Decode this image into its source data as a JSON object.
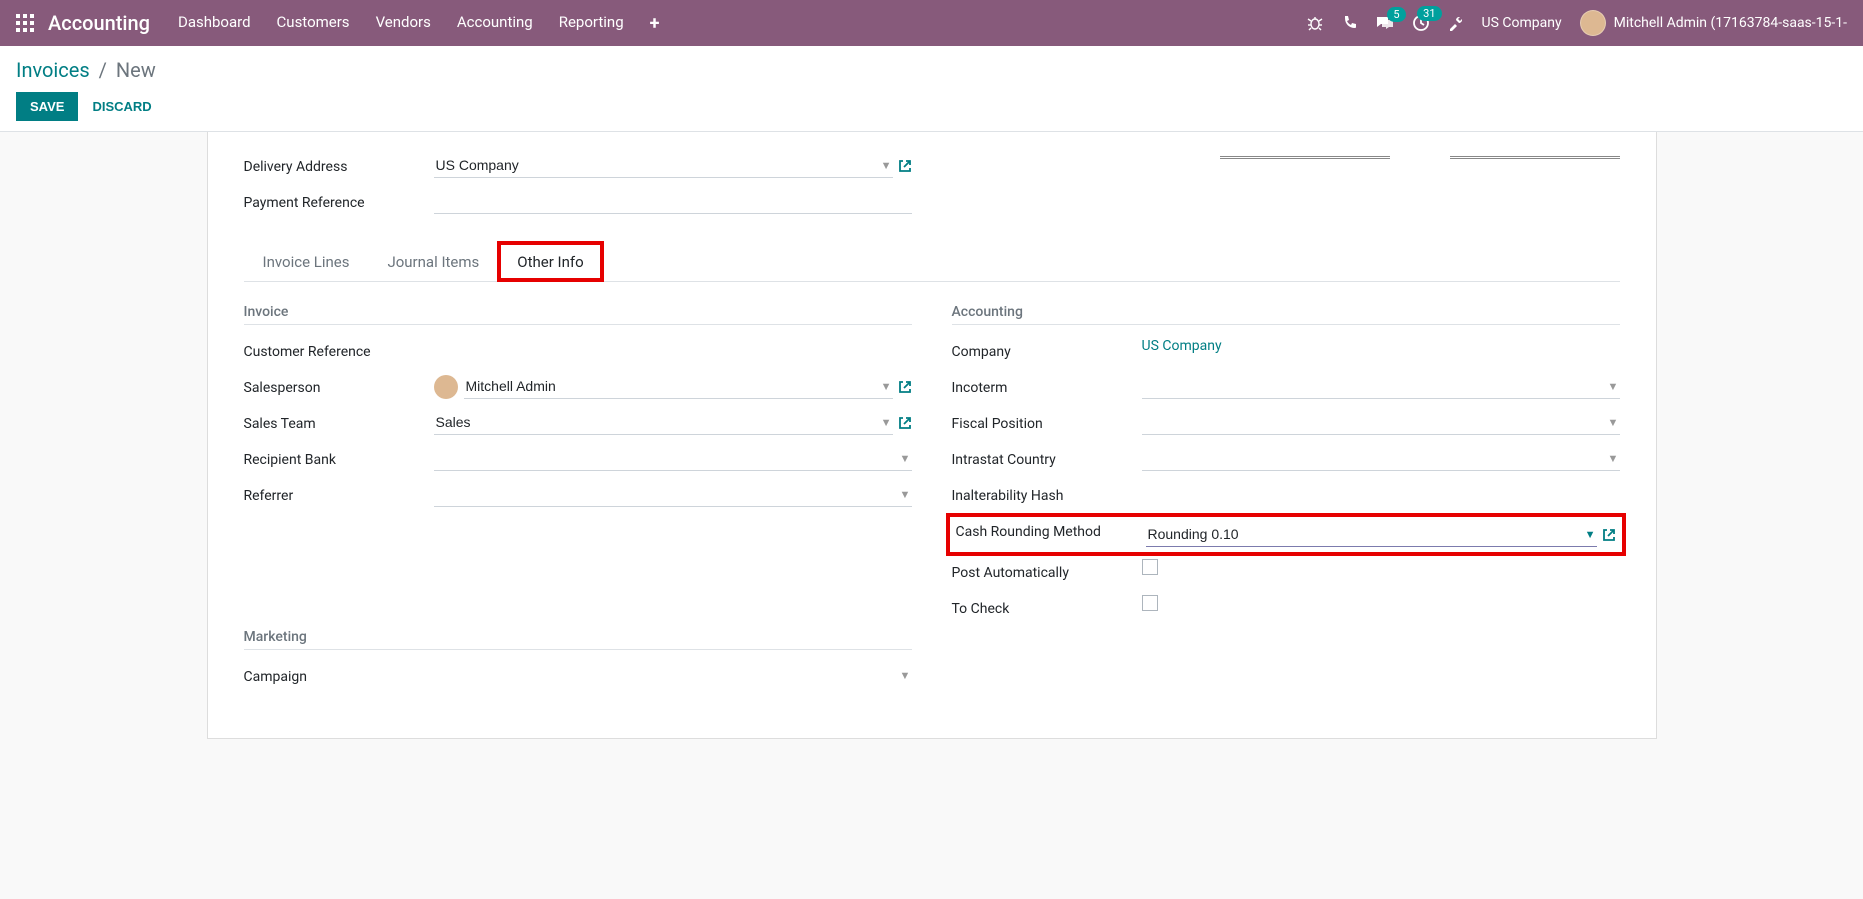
{
  "nav": {
    "brand": "Accounting",
    "items": [
      "Dashboard",
      "Customers",
      "Vendors",
      "Accounting",
      "Reporting"
    ],
    "company": "US Company",
    "user": "Mitchell Admin (17163784-saas-15-1-",
    "chat_badge": "5",
    "activity_badge": "31"
  },
  "breadcrumb": {
    "root": "Invoices",
    "leaf": "New"
  },
  "buttons": {
    "save": "SAVE",
    "discard": "DISCARD"
  },
  "form_top": {
    "delivery_address_label": "Delivery Address",
    "delivery_address_value": "US Company",
    "payment_reference_label": "Payment Reference"
  },
  "tabs": {
    "t1": "Invoice Lines",
    "t2": "Journal Items",
    "t3": "Other Info"
  },
  "sections": {
    "invoice": "Invoice",
    "accounting": "Accounting",
    "marketing": "Marketing"
  },
  "left": {
    "customer_ref": "Customer Reference",
    "salesperson": "Salesperson",
    "salesperson_val": "Mitchell Admin",
    "sales_team": "Sales Team",
    "sales_team_val": "Sales",
    "recipient_bank": "Recipient Bank",
    "referrer": "Referrer",
    "campaign": "Campaign"
  },
  "right": {
    "company": "Company",
    "company_val": "US Company",
    "incoterm": "Incoterm",
    "fiscal_position": "Fiscal Position",
    "intrastat_country": "Intrastat Country",
    "inalterability": "Inalterability Hash",
    "cash_rounding": "Cash Rounding Method",
    "cash_rounding_val": "Rounding 0.10",
    "post_auto": "Post Automatically",
    "to_check": "To Check"
  }
}
